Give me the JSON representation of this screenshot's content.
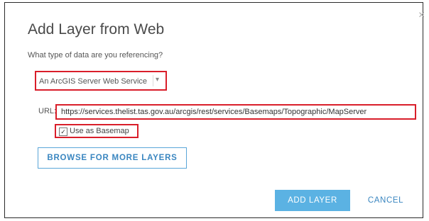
{
  "dialog": {
    "title": "Add Layer from Web",
    "close_icon": "close-icon",
    "question": "What type of data are you referencing?",
    "data_type": {
      "selected": "An ArcGIS Server Web Service",
      "caret_icon": "chevron-down-icon",
      "caret_glyph": "▾"
    },
    "url": {
      "label": "URL:",
      "value": "https://services.thelist.tas.gov.au/arcgis/rest/services/Basemaps/Topographic/MapServer"
    },
    "basemap": {
      "label": "Use as Basemap",
      "checked": true,
      "check_glyph": "✓"
    },
    "browse_label": "BROWSE FOR MORE LAYERS",
    "add_label": "ADD LAYER",
    "cancel_label": "CANCEL",
    "close_glyph": "×"
  },
  "colors": {
    "highlight": "#d91e2a",
    "primary": "#5bb2e3",
    "link": "#3a86c0"
  }
}
